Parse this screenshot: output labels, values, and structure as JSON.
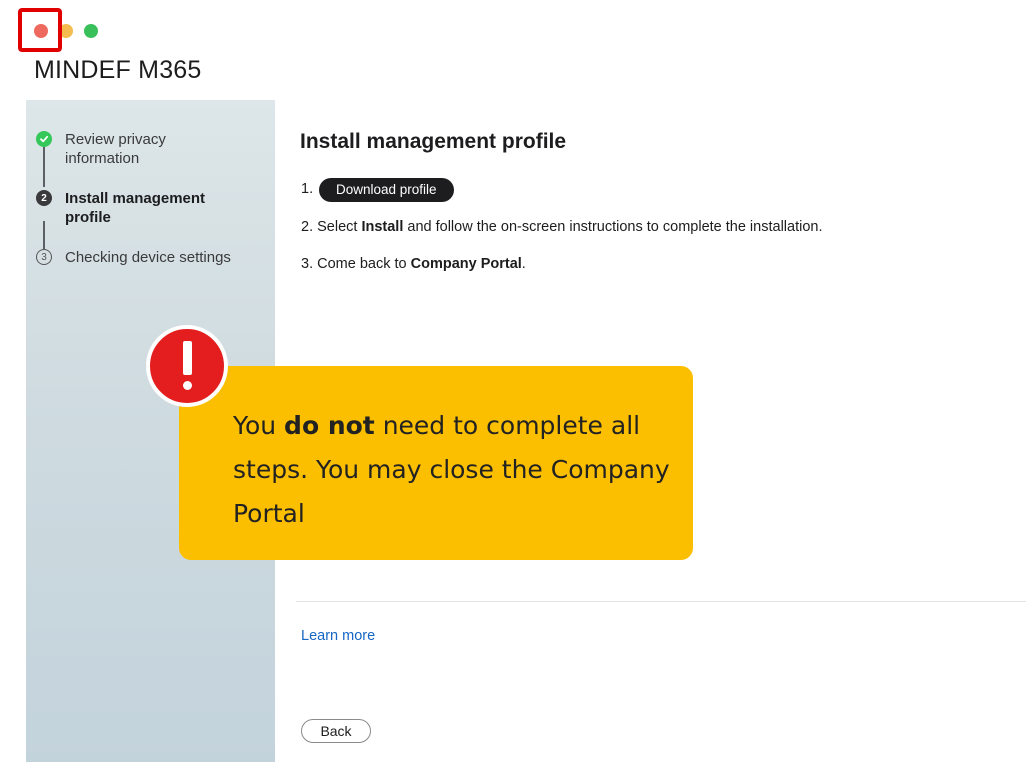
{
  "window": {
    "close_label": "close window",
    "minimize_label": "minimize window",
    "zoom_label": "zoom window"
  },
  "app_title": "MINDEF M365",
  "sidebar": {
    "steps": [
      {
        "number": "",
        "label": "Review privacy information",
        "state": "done"
      },
      {
        "number": "2",
        "label": "Install management profile",
        "state": "current"
      },
      {
        "number": "3",
        "label": "Checking device settings",
        "state": "pending"
      }
    ]
  },
  "main": {
    "title": "Install management profile",
    "step1_prefix": "1.",
    "download_button": "Download profile",
    "step2": {
      "prefix": "2. Select ",
      "bold": "Install",
      "suffix": " and follow the on-screen instructions to complete the installation."
    },
    "step3": {
      "prefix": "3. Come back to ",
      "bold": "Company Portal",
      "suffix": "."
    },
    "learn_more": "Learn more",
    "back_button": "Back"
  },
  "callout": {
    "pre": "You ",
    "bold": "do not",
    "post": " need to complete all steps. You may close the Company Portal",
    "badge_symbol": "!"
  },
  "colors": {
    "callout_bg": "#fbbf00",
    "alert_red": "#e41e1e",
    "highlight_red": "#e00000",
    "link_blue": "#1666c4",
    "done_green": "#34c759"
  }
}
